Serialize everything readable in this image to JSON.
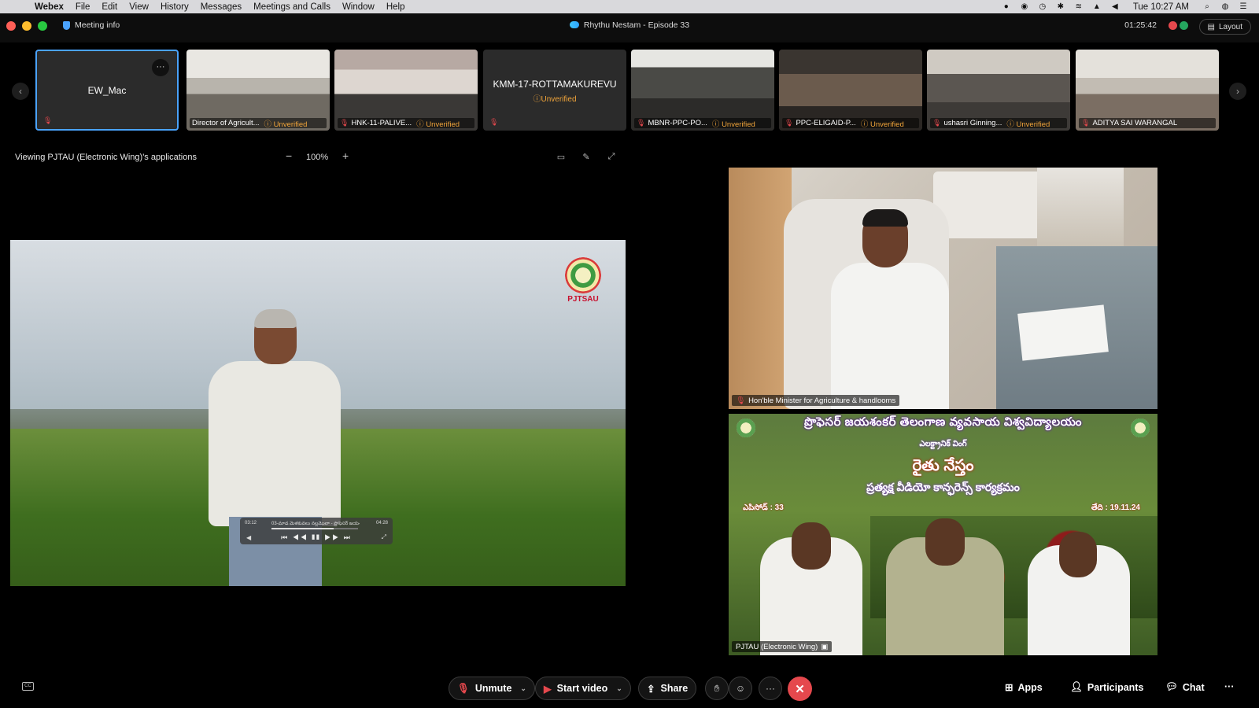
{
  "menubar": {
    "app": "Webex",
    "items": [
      "File",
      "Edit",
      "View",
      "History",
      "Messages",
      "Meetings and Calls",
      "Window",
      "Help"
    ],
    "clock": "Tue 10:27 AM"
  },
  "titlebar": {
    "meeting_info": "Meeting info",
    "title": "Rhythu Nestam - Episode 33",
    "timer": "01:25:42",
    "layout_label": "Layout"
  },
  "filmstrip": {
    "self_name": "EW_Mac",
    "tiles": [
      {
        "name": "Director of Agricult...",
        "status": "Unverified"
      },
      {
        "name": "HNK-11-PALIVE...",
        "status": "Unverified"
      },
      {
        "name": "KMM-17-ROTTAMAKUREVU",
        "status": "Unverified"
      },
      {
        "name": "MBNR-PPC-PO...",
        "status": "Unverified"
      },
      {
        "name": "PPC-ELIGAID-P...",
        "status": "Unverified"
      },
      {
        "name": "ushasri Ginning...",
        "status": "Unverified"
      },
      {
        "name": "ADITYA SAI WARANGAL",
        "status": ""
      }
    ]
  },
  "share": {
    "viewing": "Viewing PJTAU (Electronic Wing)'s applications",
    "zoom": "100%",
    "logo_text": "PJTSAU",
    "player": {
      "elapsed": "03:12",
      "remaining": "04:28",
      "title": "03-మాడ మెళకువలు నల్లమొలా - ప్రొఫెసర్ జయశంకర్...",
      "progress": 0.72
    }
  },
  "videos": [
    {
      "label": "Hon'ble Minister for Agriculture & handlooms"
    },
    {
      "label": "PJTAU (Electronic Wing)",
      "banner_title": "ప్రొఫెసర్ జయశంకర్ తెలంగాణ వ్యవసాయ విశ్వవిద్యాలయం",
      "banner_sub": "ఎలక్ట్రానిక్ వింగ్",
      "banner_main": "రైతు నేస్తం",
      "banner_line": "ప్రత్యక్ష వీడియో కాన్ఫరెన్స్ కార్యక్రమం",
      "episode": "ఎపిసోడ్ : 33",
      "date": "తేది : 19.11.24"
    }
  ],
  "toolbar": {
    "unmute": "Unmute",
    "start_video": "Start video",
    "share": "Share",
    "apps": "Apps",
    "participants": "Participants",
    "chat": "Chat"
  },
  "colors": {
    "accent": "#4aa3ff",
    "danger": "#e5484d",
    "unverified": "#f0a43a"
  }
}
